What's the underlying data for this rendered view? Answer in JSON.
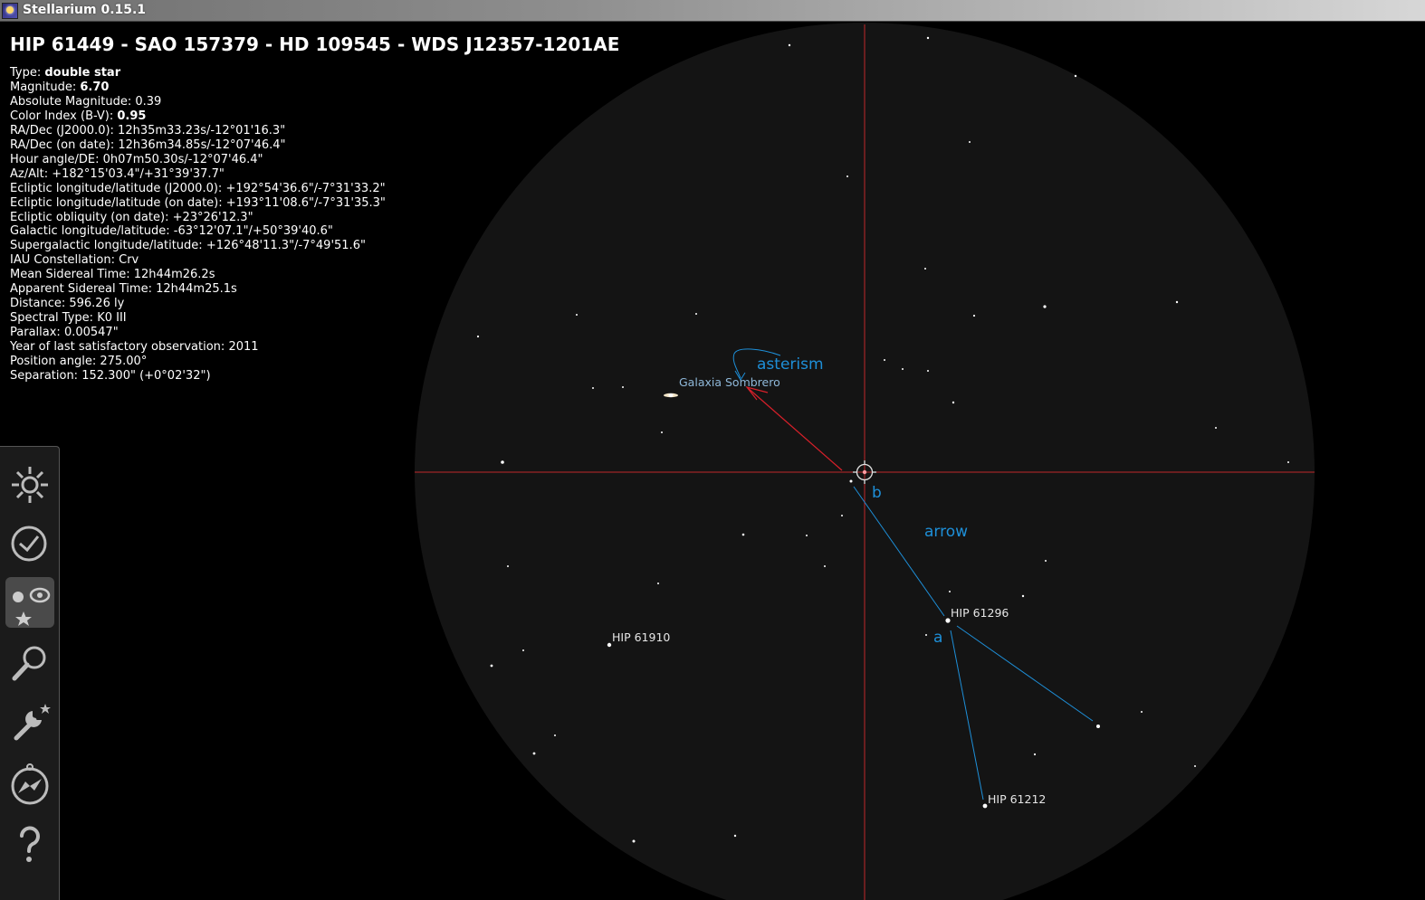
{
  "window": {
    "title": "Stellarium 0.15.1"
  },
  "object": {
    "title": "HIP 61449 - SAO 157379 - HD 109545 - WDS J12357-1201AE",
    "info": [
      {
        "label": "Type: ",
        "value": "double star",
        "bold": true
      },
      {
        "label": "Magnitude: ",
        "value": "6.70",
        "bold": true
      },
      {
        "label": "Absolute Magnitude: ",
        "value": "0.39"
      },
      {
        "label": "Color Index (B-V): ",
        "value": "0.95",
        "bold": true
      },
      {
        "label": "RA/Dec (J2000.0): ",
        "value": "12h35m33.23s/-12°01'16.3\""
      },
      {
        "label": "RA/Dec (on date): ",
        "value": "12h36m34.85s/-12°07'46.4\""
      },
      {
        "label": "Hour angle/DE: ",
        "value": "0h07m50.30s/-12°07'46.4\""
      },
      {
        "label": "Az/Alt: ",
        "value": "+182°15'03.4\"/+31°39'37.7\""
      },
      {
        "label": "Ecliptic longitude/latitude (J2000.0): ",
        "value": "+192°54'36.6\"/-7°31'33.2\""
      },
      {
        "label": "Ecliptic longitude/latitude (on date): ",
        "value": "+193°11'08.6\"/-7°31'35.3\""
      },
      {
        "label": "Ecliptic obliquity (on date): ",
        "value": "+23°26'12.3\""
      },
      {
        "label": "Galactic longitude/latitude: ",
        "value": "-63°12'07.1\"/+50°39'40.6\""
      },
      {
        "label": "Supergalactic longitude/latitude: ",
        "value": "+126°48'11.3\"/-7°49'51.6\""
      },
      {
        "label": "IAU Constellation: ",
        "value": "Crv"
      },
      {
        "label": "Mean Sidereal Time: ",
        "value": "12h44m26.2s"
      },
      {
        "label": "Apparent Sidereal Time: ",
        "value": "12h44m25.1s"
      },
      {
        "label": "Distance: ",
        "value": "596.26 ly"
      },
      {
        "label": "Spectral Type: ",
        "value": "K0 III"
      },
      {
        "label": "Parallax: ",
        "value": "0.00547\""
      },
      {
        "label": "Year of last satisfactory observation: ",
        "value": "2011"
      },
      {
        "label": "Position angle: ",
        "value": "275.00°"
      },
      {
        "label": "Separation: ",
        "value": "152.300\" (+0°02'32\")"
      }
    ]
  },
  "sky": {
    "labels": {
      "galaxy": "Galaxia Sombrero",
      "star1": "HIP 61296",
      "star2": "HIP 61910",
      "star3": "HIP 61212",
      "annot_asterism": "asterism",
      "annot_arrow": "arrow",
      "annot_a": "a",
      "annot_b": "b"
    },
    "colors": {
      "fov": "#141414",
      "crosshair": "#c0282a",
      "annotation": "#1e8fd8",
      "pointer": "#d8202a"
    }
  },
  "sidebar": {
    "buttons": [
      {
        "name": "sky-viewing-options-icon"
      },
      {
        "name": "date-time-icon"
      },
      {
        "name": "sky-and-viewing-options-icon"
      },
      {
        "name": "search-icon"
      },
      {
        "name": "configuration-icon"
      },
      {
        "name": "location-compass-icon"
      },
      {
        "name": "help-icon"
      }
    ]
  }
}
